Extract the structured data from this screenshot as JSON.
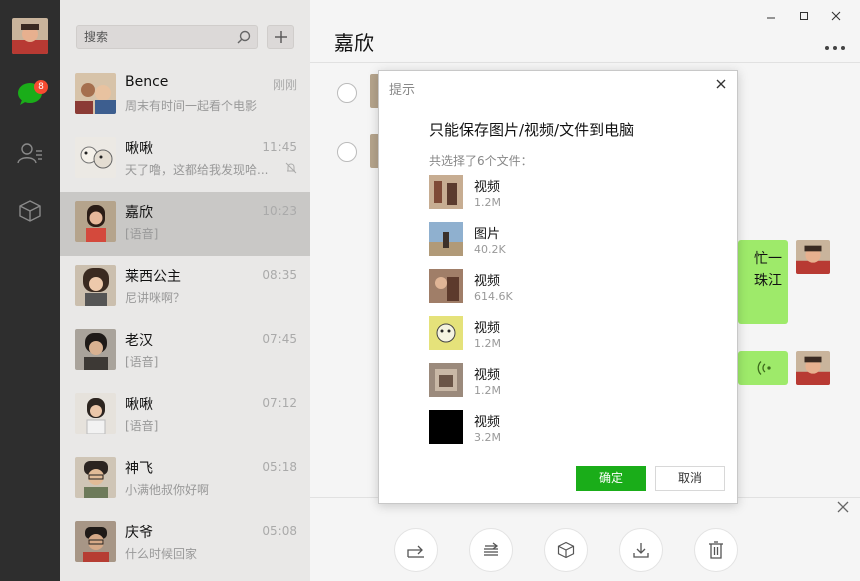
{
  "sidebar": {
    "badge_count": "8",
    "icons": [
      "chat-icon",
      "contacts-icon",
      "favorites-icon"
    ]
  },
  "search": {
    "placeholder": "搜索"
  },
  "conversations": [
    {
      "name": "Bence",
      "preview": "周末有时间一起看个电影",
      "time": "刚刚"
    },
    {
      "name": "啾啾",
      "preview": "天了噜，这都给我发现哈...",
      "time": "11:45",
      "muted": true
    },
    {
      "name": "嘉欣",
      "preview": "[语音]",
      "time": "10:23",
      "active": true
    },
    {
      "name": "莱西公主",
      "preview": "尼讲咪啊？",
      "time": "08:35"
    },
    {
      "name": "老汉",
      "preview": "[语音]",
      "time": "07:45"
    },
    {
      "name": "啾啾",
      "preview": "[语音]",
      "time": "07:12"
    },
    {
      "name": "神飞",
      "preview": "小满他叔你好啊",
      "time": "05:18"
    },
    {
      "name": "庆爷",
      "preview": "什么时候回家",
      "time": "05:08"
    }
  ],
  "chat": {
    "title": "嘉欣",
    "bubble_text_line1": "忙一",
    "bubble_text_line2": "珠江"
  },
  "dialog": {
    "title": "提示",
    "heading": "只能保存图片/视频/文件到电脑",
    "subtitle": "共选择了6个文件：",
    "files": [
      {
        "name": "视频",
        "size": "1.2M"
      },
      {
        "name": "图片",
        "size": "40.2K"
      },
      {
        "name": "视频",
        "size": "614.6K"
      },
      {
        "name": "视频",
        "size": "1.2M"
      },
      {
        "name": "视频",
        "size": "1.2M"
      },
      {
        "name": "视频",
        "size": "3.2M"
      }
    ],
    "ok_label": "确定",
    "cancel_label": "取消"
  },
  "colors": {
    "accent": "#1aad19",
    "bubble": "#9eea6a",
    "badge": "#f74c31",
    "nav": "#2e2e2e"
  }
}
